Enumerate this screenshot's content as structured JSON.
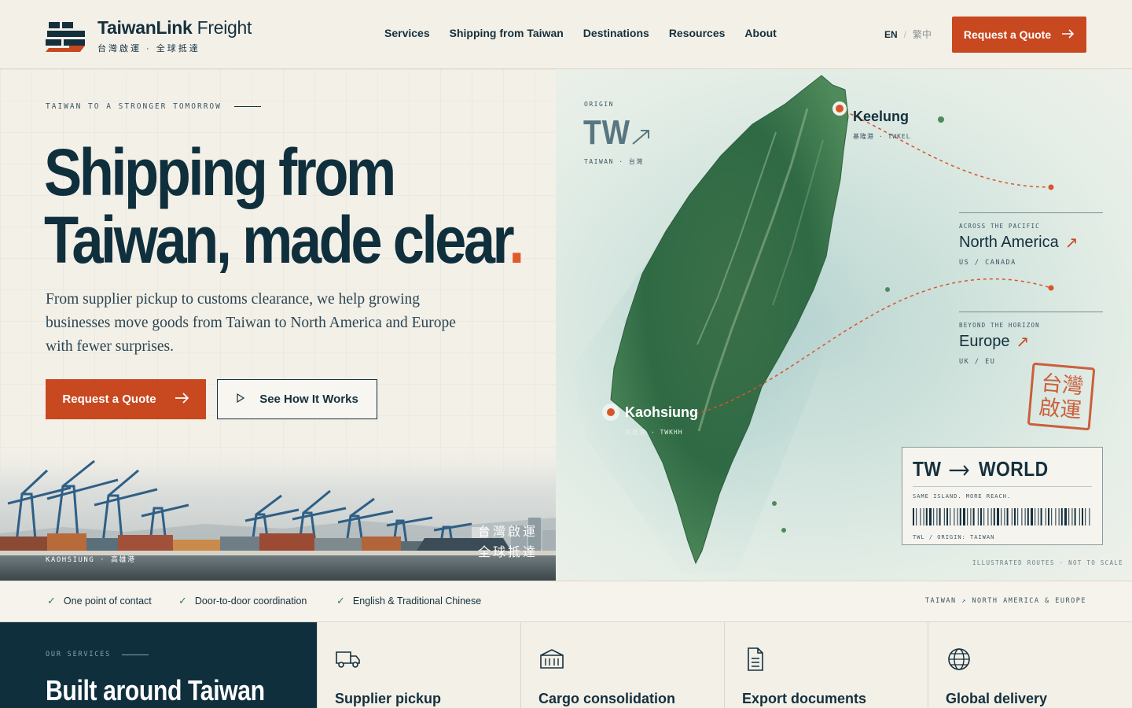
{
  "header": {
    "brand_name_bold": "TaiwanLink",
    "brand_name_light": " Freight",
    "brand_sub": "台灣啟運 · 全球抵達",
    "nav": [
      "Services",
      "Shipping from Taiwan",
      "Destinations",
      "Resources",
      "About"
    ],
    "lang_en": "EN",
    "lang_sep": "/",
    "lang_zh": "繁中",
    "quote_label": "Request a Quote"
  },
  "hero": {
    "eyebrow": "TAIWAN TO A STRONGER TOMORROW",
    "title_line1": "Shipping from",
    "title_line2": "Taiwan, made clear",
    "title_dot": ".",
    "description": "From supplier pickup to customs clearance, we help growing businesses move goods from Taiwan to North America and Europe with fewer surprises.",
    "primary_cta": "Request a Quote",
    "secondary_cta": "See How It Works",
    "photo_caption": "KAOHSIUNG · 高雄港",
    "photo_cjk_line1": "台灣啟運",
    "photo_cjk_line2": "全球抵達"
  },
  "map": {
    "origin_label": "ORIGIN",
    "origin_code": "TW",
    "origin_sub": "TAIWAN · 台灣",
    "keelung": {
      "name": "Keelung",
      "sub": "基隆港 · TWKEL"
    },
    "kaohsiung": {
      "name": "Kaohsiung",
      "sub": "高雄港 · TWKHH"
    },
    "destinations": [
      {
        "eyebrow": "ACROSS THE PACIFIC",
        "name": "North America",
        "sub": "US / CANADA"
      },
      {
        "eyebrow": "BEYOND THE HORIZON",
        "name": "Europe",
        "sub": "UK / EU"
      }
    ],
    "stamp_line1": "台灣",
    "stamp_line2": "啟運",
    "ticket": {
      "from": "TW",
      "to": "WORLD",
      "tagline": "SAME ISLAND. MORE REACH.",
      "footer": "TWL / ORIGIN: TAIWAN"
    },
    "scale_note": "ILLUSTRATED ROUTES · NOT TO SCALE"
  },
  "features": {
    "items": [
      "One point of contact",
      "Door-to-door coordination",
      "English & Traditional Chinese"
    ],
    "right_text": "TAIWAN ↗ NORTH AMERICA & EUROPE"
  },
  "services": {
    "eyebrow": "OUR SERVICES",
    "title": "Built around Taiwan",
    "cards": [
      {
        "label": "Supplier pickup",
        "icon": "truck-icon"
      },
      {
        "label": "Cargo consolidation",
        "icon": "container-icon"
      },
      {
        "label": "Export documents",
        "icon": "document-icon"
      },
      {
        "label": "Global delivery",
        "icon": "globe-icon"
      }
    ]
  },
  "colors": {
    "navy": "#0f2f3d",
    "accent": "#c8481f",
    "background": "#f3f0e8",
    "check_green": "#3d7a56"
  }
}
